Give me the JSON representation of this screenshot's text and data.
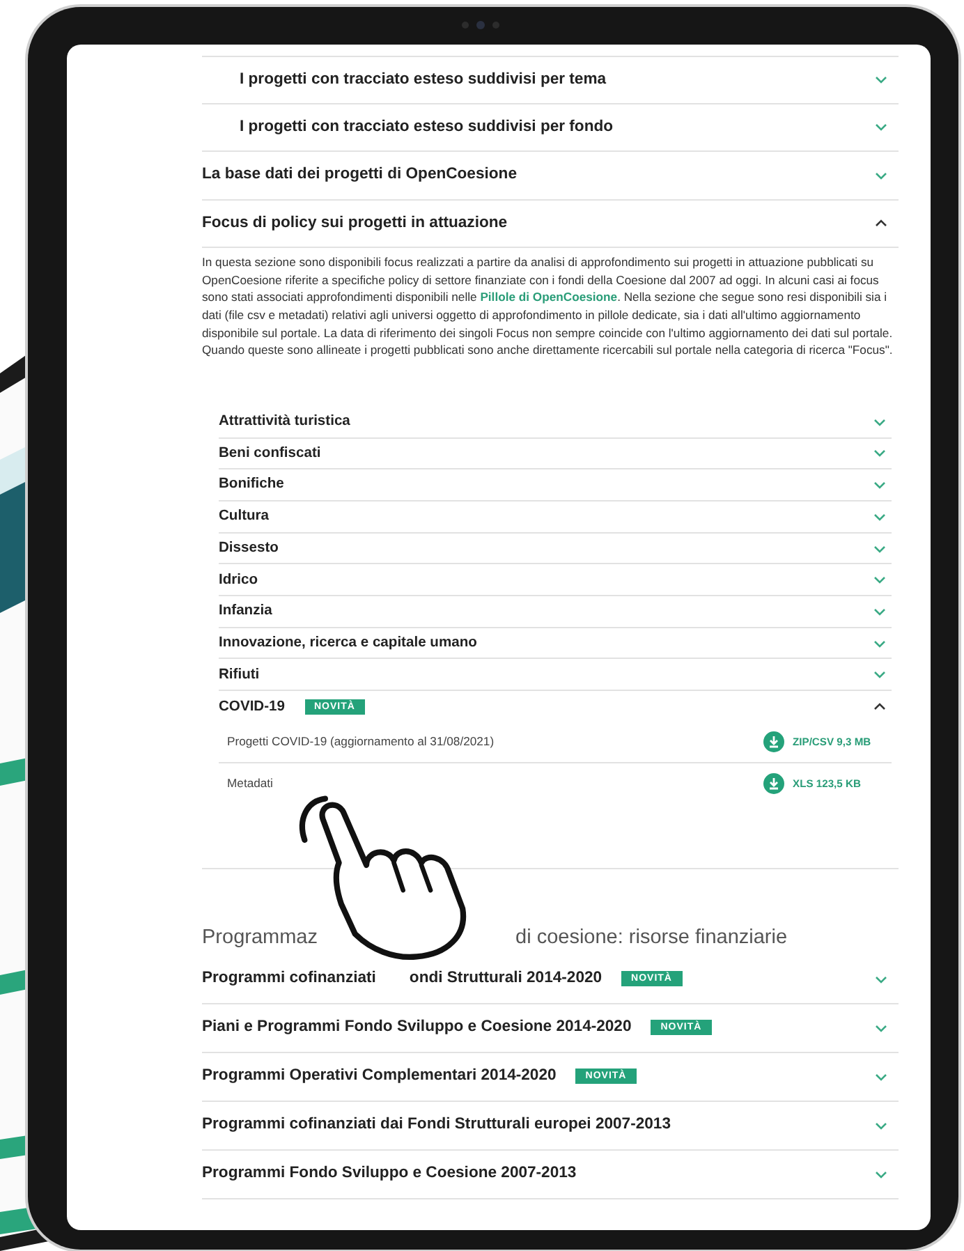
{
  "top_rows": [
    {
      "title": "I progetti con tracciato esteso suddivisi per tema",
      "kind": "subsection",
      "expanded": false
    },
    {
      "title": "I progetti con tracciato esteso suddivisi per fondo",
      "kind": "subsection",
      "expanded": false
    },
    {
      "title": "La base dati dei progetti di OpenCoesione",
      "kind": "section",
      "expanded": false
    },
    {
      "title": "Focus di policy sui progetti in attuazione",
      "kind": "section",
      "expanded": true
    }
  ],
  "focus_text": [
    {
      "kind": "text",
      "text": "In questa sezione sono disponibili focus realizzati a partire da analisi di approfondimento sui progetti in attuazione pubblicati su OpenCoesione riferite a specifiche policy di settore finanziate con i fondi della Coesione dal 2007 ad oggi. In alcuni casi ai focus sono stati associati approfondimenti disponibili nelle"
    },
    {
      "kind": "link",
      "text": "Pillole di OpenCoesione"
    },
    {
      "kind": "text",
      "text": ". Nella sezione che segue sono resi disponibili sia i dati (file csv e metadati) relativi agli universi oggetto di approfondimento in pillole dedicate, sia i dati all'ultimo aggiornamento disponibile sul portale. La data di riferimento dei singoli Focus non sempre coincide con l'ultimo aggiornamento dei dati sul portale. Quando queste sono allineate i progetti pubblicati sono anche direttamente ricercabili sul portale nella categoria di ricerca \"Focus\"."
    }
  ],
  "focus_topics": [
    {
      "title": "Attrattività turistica",
      "expanded": false
    },
    {
      "title": "Beni confiscati",
      "expanded": false
    },
    {
      "title": "Bonifiche",
      "expanded": false
    },
    {
      "title": "Cultura",
      "expanded": false
    },
    {
      "title": "Dissesto",
      "expanded": false
    },
    {
      "title": "Idrico",
      "expanded": false
    },
    {
      "title": "Infanzia",
      "expanded": false
    },
    {
      "title": "Innovazione, ricerca e capitale umano",
      "expanded": false
    },
    {
      "title": "Rifiuti",
      "expanded": false
    },
    {
      "title": "COVID-19",
      "badge": "NOVITÀ",
      "expanded": true,
      "files": [
        {
          "label": "Progetti COVID-19 (aggiornamento al 31/08/2021)",
          "download": "ZIP/CSV 9,3 MB"
        },
        {
          "label": "Metadati",
          "download": "XLS 123,5 KB"
        }
      ]
    }
  ],
  "programmazione": {
    "heading_parts": [
      "Programmaz",
      "di coesione: risorse finanziarie"
    ],
    "rows": [
      {
        "title_parts": [
          "Programmi cofinanziati",
          "ondi Strutturali 2014-2020"
        ],
        "badge": "NOVITÀ",
        "expanded": false
      },
      {
        "title_parts": [
          "Piani e Programmi Fondo Sviluppo e Coesione 2014-2020"
        ],
        "badge": "NOVITÀ",
        "expanded": false
      },
      {
        "title_parts": [
          "Programmi Operativi Complementari 2014-2020"
        ],
        "badge": "NOVITÀ",
        "expanded": false
      },
      {
        "title_parts": [
          "Programmi cofinanziati dai Fondi Strutturali europei 2007-2013"
        ],
        "expanded": false
      },
      {
        "title_parts": [
          "Programmi Fondo Sviluppo e Coesione 2007-2013"
        ],
        "expanded": false
      }
    ]
  }
}
